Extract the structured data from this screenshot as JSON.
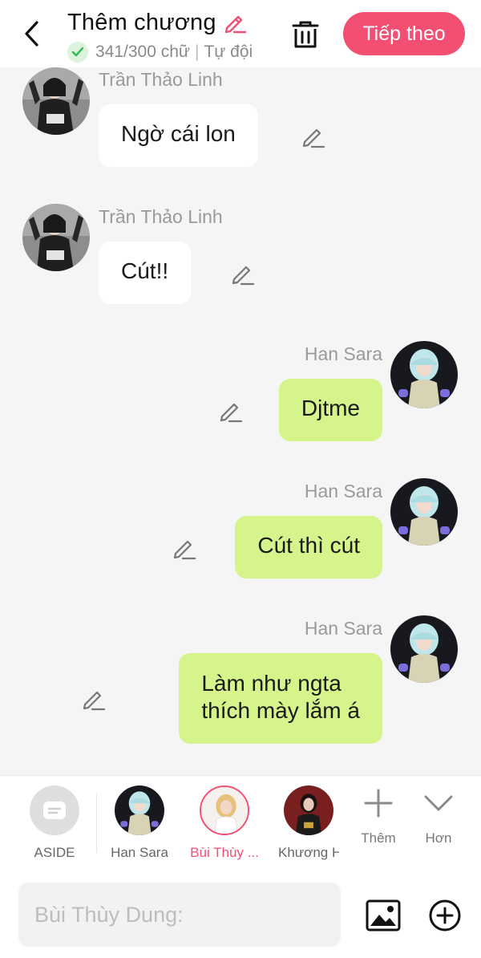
{
  "header": {
    "title": "Thêm chương",
    "word_count": "341/300 chữ",
    "separator": "|",
    "sub_label": "Tự đội",
    "next_label": "Tiếp theo",
    "accent_color": "#f34f73",
    "check_color": "#2fb84d"
  },
  "messages": [
    {
      "side": "left",
      "sender": "Trần Thảo Linh",
      "text": "Ngờ cái lon"
    },
    {
      "side": "left",
      "sender": "Trần Thảo Linh",
      "text": "Cút!!"
    },
    {
      "side": "right",
      "sender": "Han Sara",
      "text": "Djtme"
    },
    {
      "side": "right",
      "sender": "Han Sara",
      "text": "Cút thì cút"
    },
    {
      "side": "right",
      "sender": "Han Sara",
      "text_line1": "Làm như ngta",
      "text_line2": "thích mày lắm á"
    }
  ],
  "character_bar": {
    "aside_label": "ASIDE",
    "characters": [
      {
        "label": "Han Sara",
        "active": false
      },
      {
        "label": "Bùi Thùy ...",
        "active": true
      },
      {
        "label": "Khương H",
        "active": false
      }
    ],
    "more_label": "Thêm",
    "expand_label": "Hơn"
  },
  "input": {
    "placeholder": "Bùi Thùy Dung:"
  },
  "colors": {
    "bubble_right": "#d5f58c",
    "bubble_left": "#ffffff",
    "background": "#f5f5f5"
  }
}
